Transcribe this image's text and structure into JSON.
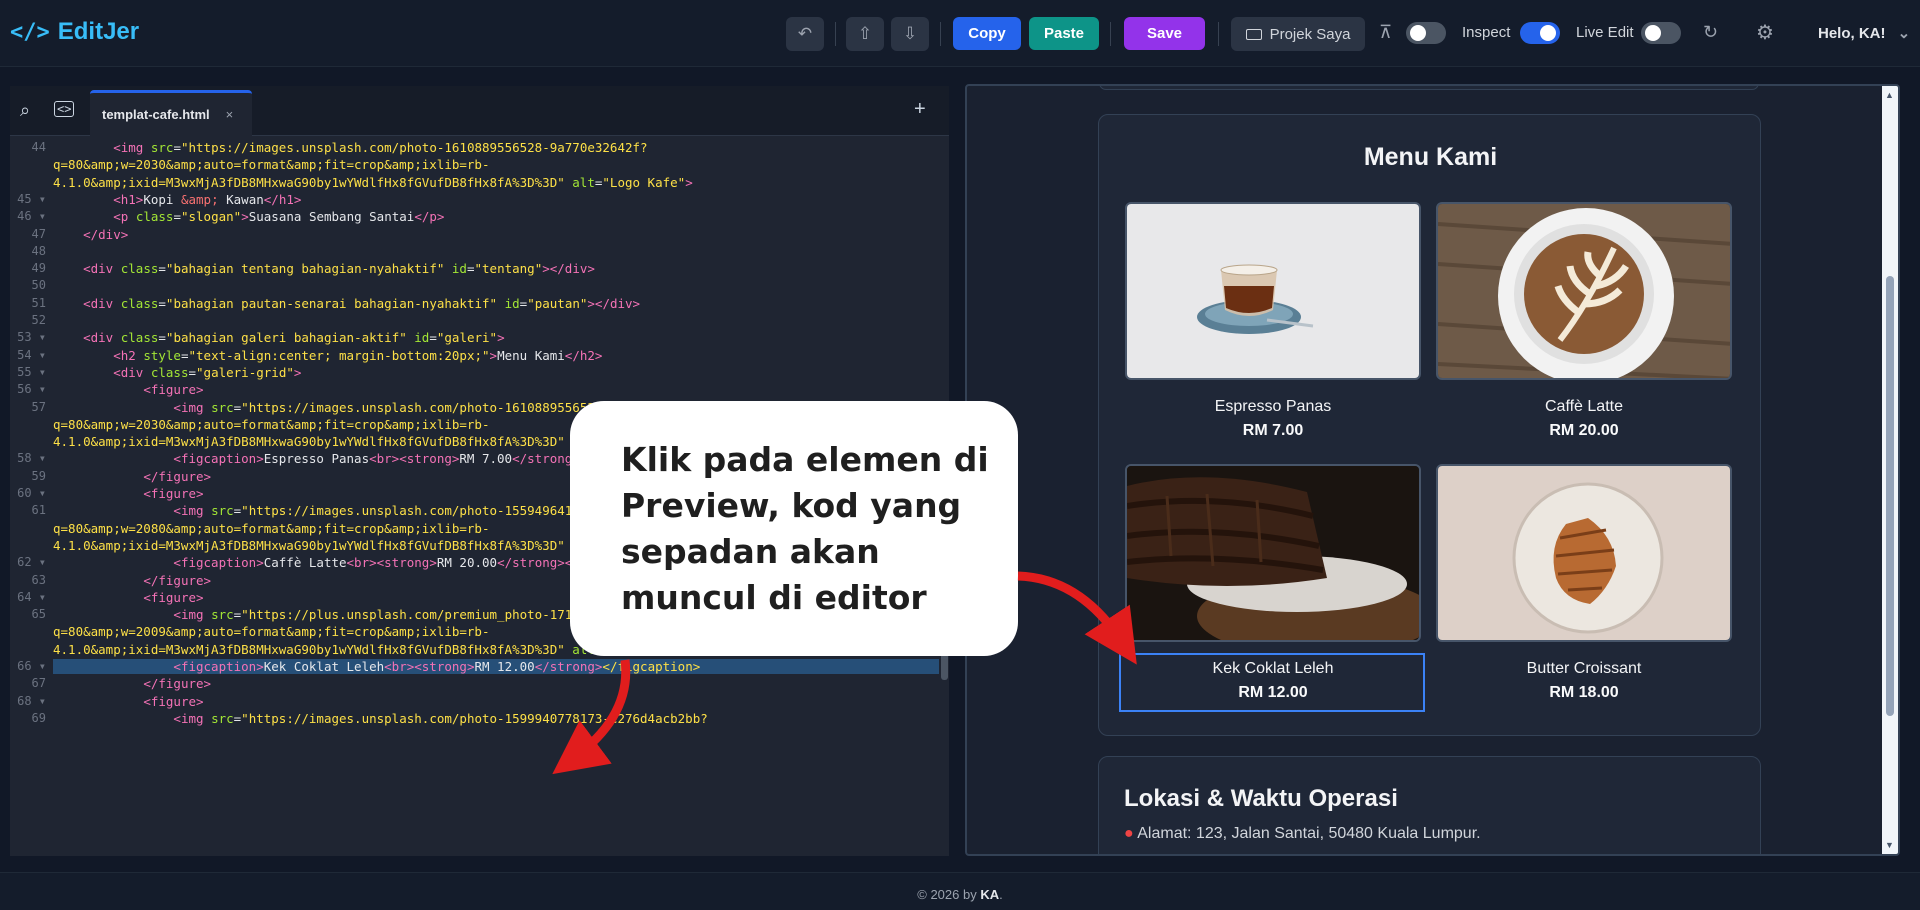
{
  "app": {
    "name": "EditJer",
    "logo_icon": "code-brackets-icon"
  },
  "toolbar": {
    "copy_label": "Copy",
    "paste_label": "Paste",
    "save_label": "Save",
    "project_label": "Projek Saya",
    "inspect_label": "Inspect",
    "live_edit_label": "Live Edit",
    "user_greeting": "Helo, KA!",
    "colors": {
      "copy": "#2563eb",
      "paste": "#0d9488",
      "save": "#9333ea",
      "toggle_on": "#2563eb",
      "toggle_off": "#4b5563"
    },
    "toggles": {
      "layout": false,
      "inspect": true,
      "live_edit": false
    }
  },
  "editor": {
    "tab_name": "templat-cafe.html",
    "tab_close": "×",
    "add_tab": "+",
    "lines": [
      {
        "n": "44",
        "fold": false,
        "html": "        <span class=\"t\">&lt;img</span> <span class=\"a\">src</span>=<span class=\"s\">\"https://images.unsplash.com/photo-1610889556528-9a770e32642f?</span>"
      },
      {
        "n": "",
        "fold": false,
        "html": "<span class=\"s\">q=80&amp;amp;w=2030&amp;amp;auto=format&amp;amp;fit=crop&amp;amp;ixlib=rb-</span>"
      },
      {
        "n": "",
        "fold": false,
        "html": "<span class=\"s\">4.1.0&amp;amp;ixid=M3wxMjA3fDB8MHxwaG90by1wYWdlfHx8fGVufDB8fHx8fA%3D%3D\"</span> <span class=\"a\">alt</span>=<span class=\"s\">\"Logo Kafe\"</span><span class=\"t\">&gt;</span>"
      },
      {
        "n": "45",
        "fold": true,
        "html": "        <span class=\"t\">&lt;h1&gt;</span>Kopi <span class=\"e\">&amp;amp;</span> Kawan<span class=\"t\">&lt;/h1&gt;</span>"
      },
      {
        "n": "46",
        "fold": true,
        "html": "        <span class=\"t\">&lt;p</span> <span class=\"a\">class</span>=<span class=\"s\">\"slogan\"</span><span class=\"t\">&gt;</span>Suasana Sembang Santai<span class=\"t\">&lt;/p&gt;</span>"
      },
      {
        "n": "47",
        "fold": false,
        "html": "    <span class=\"t\">&lt;/div&gt;</span>"
      },
      {
        "n": "48",
        "fold": false,
        "html": ""
      },
      {
        "n": "49",
        "fold": false,
        "html": "    <span class=\"t\">&lt;div</span> <span class=\"a\">class</span>=<span class=\"s\">\"bahagian tentang bahagian-nyahaktif\"</span> <span class=\"a\">id</span>=<span class=\"s\">\"tentang\"</span><span class=\"t\">&gt;&lt;/div&gt;</span>"
      },
      {
        "n": "50",
        "fold": false,
        "html": ""
      },
      {
        "n": "51",
        "fold": false,
        "html": "    <span class=\"t\">&lt;div</span> <span class=\"a\">class</span>=<span class=\"s\">\"bahagian pautan-senarai bahagian-nyahaktif\"</span> <span class=\"a\">id</span>=<span class=\"s\">\"pautan\"</span><span class=\"t\">&gt;&lt;/div&gt;</span>"
      },
      {
        "n": "52",
        "fold": false,
        "html": ""
      },
      {
        "n": "53",
        "fold": true,
        "html": "    <span class=\"t\">&lt;div</span> <span class=\"a\">class</span>=<span class=\"s\">\"bahagian galeri bahagian-aktif\"</span> <span class=\"a\">id</span>=<span class=\"s\">\"galeri\"</span><span class=\"t\">&gt;</span>"
      },
      {
        "n": "54",
        "fold": true,
        "html": "        <span class=\"t\">&lt;h2</span> <span class=\"a\">style</span>=<span class=\"s\">\"text-align:center; margin-bottom:20px;\"</span><span class=\"t\">&gt;</span>Menu Kami<span class=\"t\">&lt;/h2&gt;</span>"
      },
      {
        "n": "55",
        "fold": true,
        "html": "        <span class=\"t\">&lt;div</span> <span class=\"a\">class</span>=<span class=\"s\">\"galeri-grid\"</span><span class=\"t\">&gt;</span>"
      },
      {
        "n": "56",
        "fold": true,
        "html": "            <span class=\"t\">&lt;figure&gt;</span>"
      },
      {
        "n": "57",
        "fold": false,
        "html": "                <span class=\"t\">&lt;img</span> <span class=\"a\">src</span>=<span class=\"s\">\"https://images.unsplash.com/photo-1610889556528-9a770e32642f?</span>"
      },
      {
        "n": "",
        "fold": false,
        "html": "<span class=\"s\">q=80&amp;amp;w=2030&amp;amp;auto=format&amp;amp;fit=crop&amp;amp;ixlib=rb-</span>"
      },
      {
        "n": "",
        "fold": false,
        "html": "<span class=\"s\">4.1.0&amp;amp;ixid=M3wxMjA3fDB8MHxwaG90by1wYWdlfHx8fGVufDB8fHx8fA%3D%3D\"</span>"
      },
      {
        "n": "58",
        "fold": true,
        "html": "                <span class=\"t\">&lt;figcaption&gt;</span>Espresso Panas<span class=\"t\">&lt;br&gt;&lt;strong&gt;</span>RM 7.00<span class=\"t\">&lt;/strong&gt;&lt;/figcaption&gt;</span>"
      },
      {
        "n": "59",
        "fold": false,
        "html": "            <span class=\"t\">&lt;/figure&gt;</span>"
      },
      {
        "n": "60",
        "fold": true,
        "html": "            <span class=\"t\">&lt;figure&gt;</span>"
      },
      {
        "n": "61",
        "fold": false,
        "html": "                <span class=\"t\">&lt;img</span> <span class=\"a\">src</span>=<span class=\"s\">\"https://images.unsplash.com/photo-1559496417-e7f25cb247f3?</span>"
      },
      {
        "n": "",
        "fold": false,
        "html": "<span class=\"s\">q=80&amp;amp;w=2080&amp;amp;auto=format&amp;amp;fit=crop&amp;amp;ixlib=rb-</span>"
      },
      {
        "n": "",
        "fold": false,
        "html": "<span class=\"s\">4.1.0&amp;amp;ixid=M3wxMjA3fDB8MHxwaG90by1wYWdlfHx8fGVufDB8fHx8fA%3D%3D\"</span>"
      },
      {
        "n": "62",
        "fold": true,
        "html": "                <span class=\"t\">&lt;figcaption&gt;</span>Caffè Latte<span class=\"t\">&lt;br&gt;&lt;strong&gt;</span>RM 20.00<span class=\"t\">&lt;/strong&gt;&lt;/figcaption&gt;</span>"
      },
      {
        "n": "63",
        "fold": false,
        "html": "            <span class=\"t\">&lt;/figure&gt;</span>"
      },
      {
        "n": "64",
        "fold": true,
        "html": "            <span class=\"t\">&lt;figure&gt;</span>"
      },
      {
        "n": "65",
        "fold": false,
        "html": "                <span class=\"t\">&lt;img</span> <span class=\"a\">src</span>=<span class=\"s\">\"https://plus.unsplash.com/premium_photo-1713867522131-af9733323bc1?</span>"
      },
      {
        "n": "",
        "fold": false,
        "html": "<span class=\"s\">q=80&amp;amp;w=2009&amp;amp;auto=format&amp;amp;fit=crop&amp;amp;ixlib=rb-</span>"
      },
      {
        "n": "",
        "fold": false,
        "html": "<span class=\"s\">4.1.0&amp;amp;ixid=M3wxMjA3fDB8MHxwaG90by1wYWdlfHx8fGVufDB8fHx8fA%3D%3D\"</span> <span class=\"a\">alt</span>=<span class=\"s\">\"Kek Coklat\"</span><span class=\"t\">&gt;</span>"
      },
      {
        "n": "66",
        "fold": true,
        "hl": true,
        "html": "                <span class=\"t\">&lt;figcaption&gt;</span>Kek Coklat Leleh<span class=\"t\">&lt;br&gt;&lt;strong&gt;</span>RM 12.00<span class=\"t\">&lt;/strong&gt;</span><span class=\"s\">&lt;/figcaption&gt;</span>"
      },
      {
        "n": "67",
        "fold": false,
        "html": "            <span class=\"t\">&lt;/figure&gt;</span>"
      },
      {
        "n": "68",
        "fold": true,
        "html": "            <span class=\"t\">&lt;figure&gt;</span>"
      },
      {
        "n": "69",
        "fold": false,
        "html": "                <span class=\"t\">&lt;img</span> <span class=\"a\">src</span>=<span class=\"s\">\"https://images.unsplash.com/photo-1599940778173-e276d4acb2bb?</span>"
      }
    ]
  },
  "preview": {
    "menu_title": "Menu Kami",
    "items": [
      {
        "name": "Espresso Panas",
        "price": "RM 7.00",
        "photo": "espresso"
      },
      {
        "name": "Caffè Latte",
        "price": "RM 20.00",
        "photo": "latte"
      },
      {
        "name": "Kek Coklat Leleh",
        "price": "RM 12.00",
        "photo": "cake"
      },
      {
        "name": "Butter Croissant",
        "price": "RM 18.00",
        "photo": "croissant"
      }
    ],
    "location_title": "Lokasi & Waktu Operasi",
    "location_address": "Alamat: 123, Jalan Santai, 50480 Kuala Lumpur."
  },
  "callout": {
    "text": "Klik pada elemen di Preview, kod yang sepadan akan muncul di editor"
  },
  "footer": {
    "prefix": "© 2026 by ",
    "author": "KA",
    "suffix": "."
  }
}
